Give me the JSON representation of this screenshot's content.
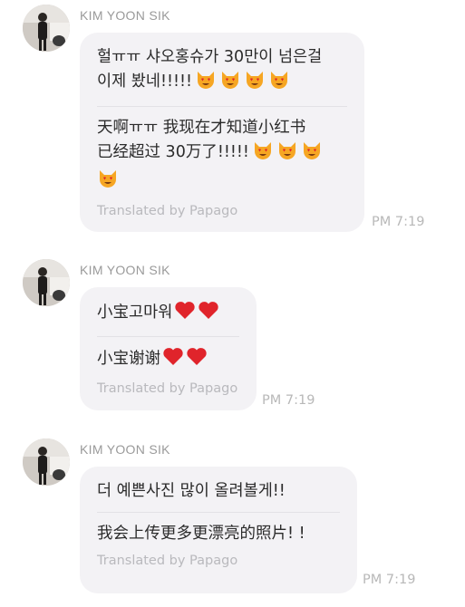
{
  "colors": {
    "bubble_bg": "#f3f2f5",
    "sender_text": "#9a9a9a",
    "translated_text": "#b9b9bd",
    "time_text": "#b8b8b8",
    "heart": "#e0242b"
  },
  "messages": [
    {
      "sender": "KIM YOON SIK",
      "original_lines": [
        "헐ㅠㅠ 샤오홍슈가 30만이 넘은걸",
        "이제 봤네!!!!!"
      ],
      "original_suffix_icons": [
        "heart-eyes-cat-emoji",
        "heart-eyes-cat-emoji",
        "heart-eyes-cat-emoji",
        "heart-eyes-cat-emoji"
      ],
      "translated_lines": [
        "天啊ㅠㅠ 我现在才知道小红书",
        "已经超过 30万了!!!!!"
      ],
      "translated_suffix_icons": [
        "heart-eyes-cat-emoji",
        "heart-eyes-cat-emoji",
        "heart-eyes-cat-emoji",
        "heart-eyes-cat-emoji"
      ],
      "translated_by": "Translated by Papago",
      "time": "PM 7:19"
    },
    {
      "sender": "KIM YOON SIK",
      "original_lines": [
        "小宝고마워"
      ],
      "original_suffix_icons": [
        "red-heart-emoji",
        "red-heart-emoji"
      ],
      "translated_lines": [
        "小宝谢谢"
      ],
      "translated_suffix_icons": [
        "red-heart-emoji",
        "red-heart-emoji"
      ],
      "translated_by": "Translated by Papago",
      "time": "PM 7:19"
    },
    {
      "sender": "KIM YOON SIK",
      "original_lines": [
        "더 예쁜사진 많이 올려볼게!!"
      ],
      "translated_lines": [
        "我会上传更多更漂亮的照片! !"
      ],
      "translated_by": "Translated by Papago",
      "time": "PM 7:19"
    }
  ]
}
